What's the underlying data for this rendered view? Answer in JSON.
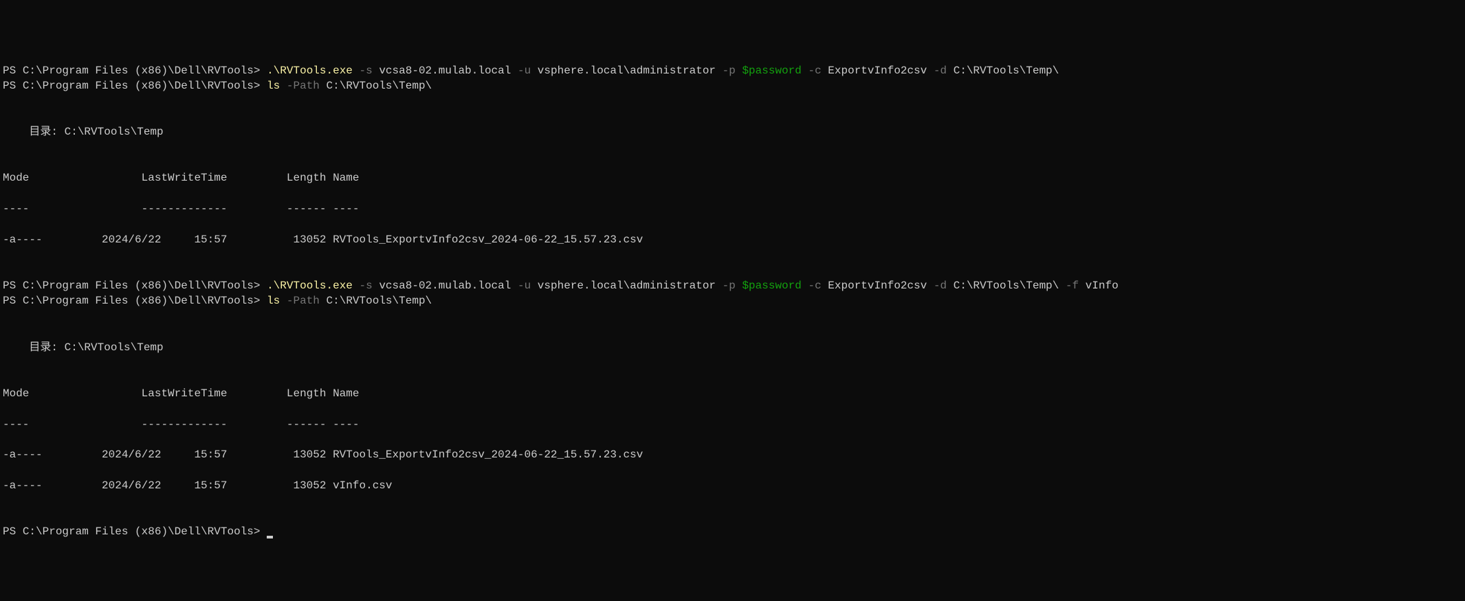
{
  "prompt1": {
    "ps": "PS ",
    "path": "C:\\Program Files (x86)\\Dell\\RVTools",
    "arrow": "> ",
    "exe": ".\\RVTools.exe",
    "sp1": " ",
    "flag_s": "-s",
    "sp2": " ",
    "host": "vcsa8-02.mulab.local",
    "sp3": " ",
    "flag_u": "-u",
    "sp4": " ",
    "user": "vsphere.local\\administrator",
    "sp5": " ",
    "flag_p": "-p",
    "sp6": " ",
    "password": "$password",
    "sp7": " ",
    "flag_c": "-c",
    "sp8": " ",
    "cmd": "ExportvInfo2csv",
    "sp9": " ",
    "flag_d": "-d",
    "sp10": " ",
    "dest": "C:\\RVTools\\Temp\\"
  },
  "prompt2": {
    "ps": "PS ",
    "path": "C:\\Program Files (x86)\\Dell\\RVTools",
    "arrow": "> ",
    "cmd": "ls",
    "sp1": " ",
    "flag": "-Path",
    "sp2": " ",
    "arg": "C:\\RVTools\\Temp\\"
  },
  "dir1": {
    "label": "\n\n    目录: C:\\RVTools\\Temp\n\n"
  },
  "header1": {
    "line1": "\nMode                 LastWriteTime         Length Name",
    "line2": "----                 -------------         ------ ----"
  },
  "row1": {
    "text": "-a----         2024/6/22     15:57          13052 RVTools_ExportvInfo2csv_2024-06-22_15.57.23.csv"
  },
  "prompt3": {
    "ps": "\n\nPS ",
    "path": "C:\\Program Files (x86)\\Dell\\RVTools",
    "arrow": "> ",
    "exe": ".\\RVTools.exe",
    "sp1": " ",
    "flag_s": "-s",
    "sp2": " ",
    "host": "vcsa8-02.mulab.local",
    "sp3": " ",
    "flag_u": "-u",
    "sp4": " ",
    "user": "vsphere.local\\administrator",
    "sp5": " ",
    "flag_p": "-p",
    "sp6": " ",
    "password": "$password",
    "sp7": " ",
    "flag_c": "-c",
    "sp8": " ",
    "cmd": "ExportvInfo2csv",
    "sp9": " ",
    "flag_d": "-d",
    "sp10": " ",
    "dest": "C:\\RVTools\\Temp\\",
    "sp11": " ",
    "flag_f": "-f",
    "sp12": " ",
    "file": "vInfo"
  },
  "prompt4": {
    "ps": "PS ",
    "path": "C:\\Program Files (x86)\\Dell\\RVTools",
    "arrow": "> ",
    "cmd": "ls",
    "sp1": " ",
    "flag": "-Path",
    "sp2": " ",
    "arg": "C:\\RVTools\\Temp\\"
  },
  "dir2": {
    "label": "\n\n    目录: C:\\RVTools\\Temp\n\n"
  },
  "header2": {
    "line1": "\nMode                 LastWriteTime         Length Name",
    "line2": "----                 -------------         ------ ----"
  },
  "row2a": {
    "text": "-a----         2024/6/22     15:57          13052 RVTools_ExportvInfo2csv_2024-06-22_15.57.23.csv"
  },
  "row2b": {
    "text": "-a----         2024/6/22     15:57          13052 vInfo.csv"
  },
  "prompt5": {
    "ps": "\n\nPS ",
    "path": "C:\\Program Files (x86)\\Dell\\RVTools",
    "arrow": "> "
  }
}
